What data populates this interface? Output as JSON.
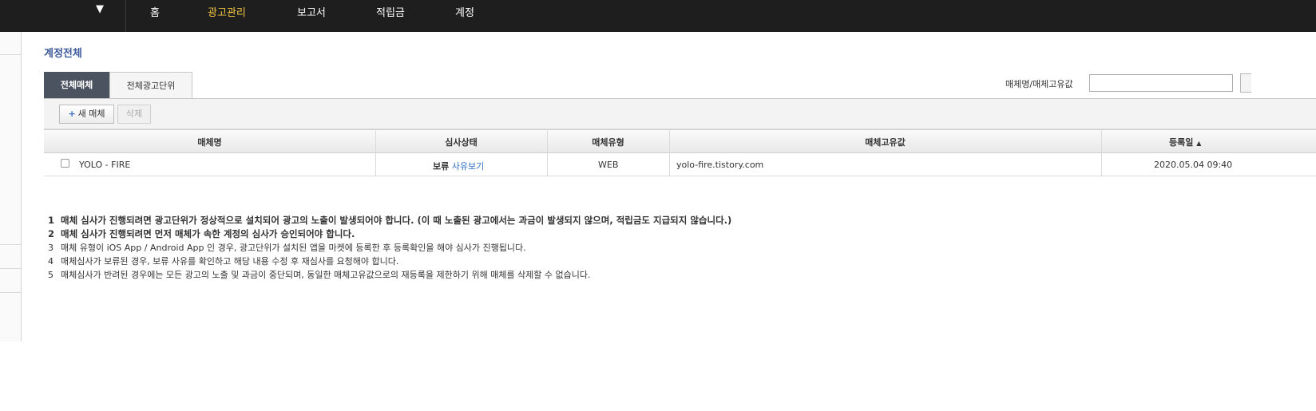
{
  "nav": {
    "dropdown_icon": "▼",
    "items": [
      "홈",
      "광고관리",
      "보고서",
      "적립금",
      "계정"
    ],
    "active_index": 1,
    "active_color": "#f2c744"
  },
  "page": {
    "title": "계정전체"
  },
  "tabs": [
    {
      "label": "전체매체",
      "active": true
    },
    {
      "label": "전체광고단위",
      "active": false
    }
  ],
  "search": {
    "label": "매체명/매체고유값",
    "value": "",
    "placeholder": ""
  },
  "toolbar": {
    "new_icon": "+",
    "new_label": "새 매체",
    "delete_label": "삭제"
  },
  "table": {
    "headers": {
      "name": "매체명",
      "status": "심사상태",
      "type": "매체유형",
      "unique_id": "매체고유값",
      "registered": "등록일",
      "sort_icon": "▲"
    },
    "rows": [
      {
        "checked": false,
        "name": "YOLO - FIRE",
        "status": "보류",
        "status_link": "사유보기",
        "type": "WEB",
        "unique_id": "yolo-fire.tistory.com",
        "registered": "2020.05.04 09:40"
      }
    ]
  },
  "notes": [
    {
      "num": "1",
      "text": "매체 심사가 진행되려면 광고단위가 정상적으로 설치되어 광고의 노출이 발생되어야 합니다. (이 때 노출된 광고에서는 과금이 발생되지 않으며, 적립금도 지급되지 않습니다.)"
    },
    {
      "num": "2",
      "text": "매체 심사가 진행되려면 먼저 매체가 속한 계정의 심사가 승인되어야 합니다."
    },
    {
      "num": "3",
      "text": "매체 유형이 iOS App / Android App 인 경우, 광고단위가 설치된 앱을 마켓에 등록한 후 등록확인을 해야 심사가 진행됩니다."
    },
    {
      "num": "4",
      "text": "매체심사가 보류된 경우, 보류 사유를 확인하고 해당 내용 수정 후 재심사를 요청해야 합니다."
    },
    {
      "num": "5",
      "text": "매체심사가 반려된 경우에는 모든 광고의 노출 및 과금이 중단되며, 동일한 매체고유값으로의 재등록을 제한하기 위해 매체를 삭제할 수 없습니다."
    }
  ]
}
